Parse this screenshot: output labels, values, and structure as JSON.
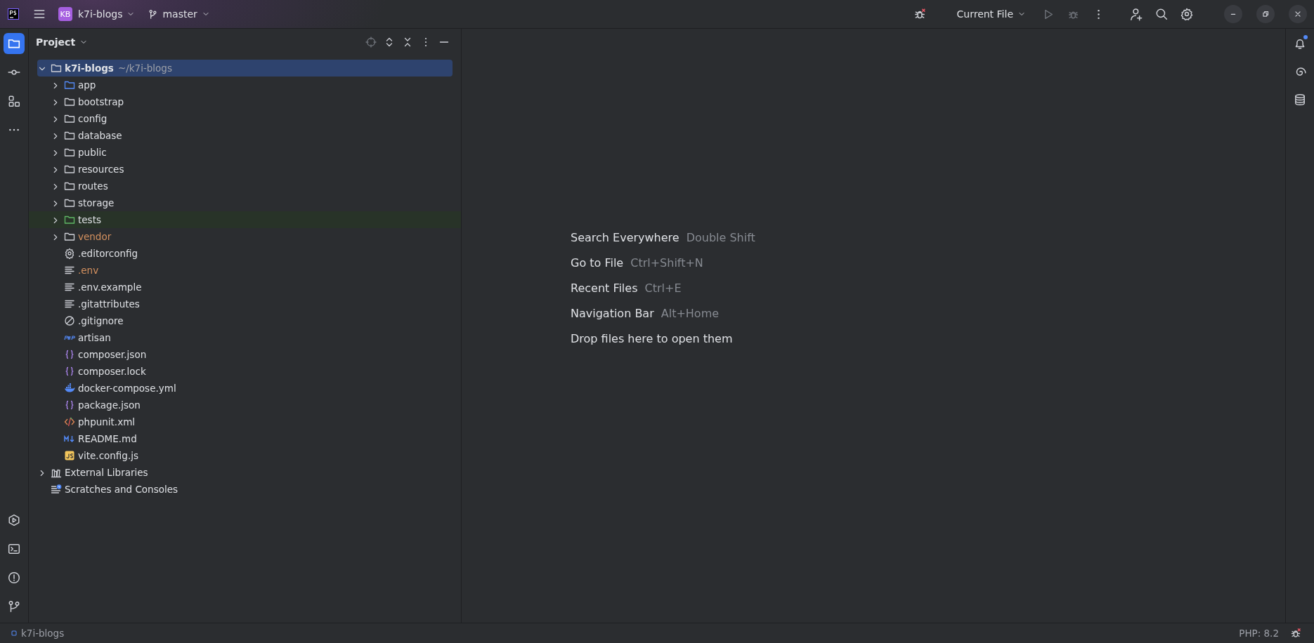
{
  "title_bar": {
    "project_badge": "KB",
    "project": "k7i-blogs",
    "branch": "master",
    "run_config": "Current File"
  },
  "left_tools": [
    {
      "kind": "project",
      "selected": true
    },
    {
      "kind": "commit",
      "selected": false
    },
    {
      "kind": "structure",
      "selected": false
    },
    {
      "kind": "more",
      "selected": false
    }
  ],
  "bottom_tools": [
    {
      "kind": "services"
    },
    {
      "kind": "terminal"
    },
    {
      "kind": "problems"
    },
    {
      "kind": "git"
    }
  ],
  "right_tools": [
    {
      "kind": "notifications",
      "unread": true
    },
    {
      "kind": "assistant"
    },
    {
      "kind": "database"
    }
  ],
  "project_panel": {
    "title": "Project",
    "tree": [
      {
        "label": "k7i-blogs",
        "path": "~/k7i-blogs",
        "kind": "folder",
        "excluded": false,
        "selected": true,
        "expanded": true,
        "children": [
          {
            "label": "app",
            "kind": "source-folder",
            "excluded": false,
            "selected": false,
            "expanded": false
          },
          {
            "label": "bootstrap",
            "kind": "folder",
            "excluded": false,
            "selected": false,
            "expanded": false
          },
          {
            "label": "config",
            "kind": "folder",
            "excluded": false,
            "selected": false,
            "expanded": false
          },
          {
            "label": "database",
            "kind": "folder",
            "excluded": false,
            "selected": false,
            "expanded": false
          },
          {
            "label": "public",
            "kind": "folder",
            "excluded": false,
            "selected": false,
            "expanded": false
          },
          {
            "label": "resources",
            "kind": "folder",
            "excluded": false,
            "selected": false,
            "expanded": false
          },
          {
            "label": "routes",
            "kind": "folder",
            "excluded": false,
            "selected": false,
            "expanded": false
          },
          {
            "label": "storage",
            "kind": "folder",
            "excluded": false,
            "selected": false,
            "expanded": false
          },
          {
            "label": "tests",
            "kind": "test-folder",
            "excluded": false,
            "selected": false,
            "expanded": false
          },
          {
            "label": "vendor",
            "kind": "folder",
            "excluded": true,
            "selected": false,
            "expanded": false
          },
          {
            "label": ".editorconfig",
            "kind": "settings",
            "excluded": false,
            "selected": false
          },
          {
            "label": ".env",
            "kind": "text",
            "excluded": true,
            "selected": false
          },
          {
            "label": ".env.example",
            "kind": "text",
            "excluded": false,
            "selected": false
          },
          {
            "label": ".gitattributes",
            "kind": "text",
            "excluded": false,
            "selected": false
          },
          {
            "label": ".gitignore",
            "kind": "ignore",
            "excluded": false,
            "selected": false
          },
          {
            "label": "artisan",
            "kind": "php",
            "excluded": false,
            "selected": false
          },
          {
            "label": "composer.json",
            "kind": "json",
            "excluded": false,
            "selected": false
          },
          {
            "label": "composer.lock",
            "kind": "json",
            "excluded": false,
            "selected": false
          },
          {
            "label": "docker-compose.yml",
            "kind": "docker",
            "excluded": false,
            "selected": false
          },
          {
            "label": "package.json",
            "kind": "json",
            "excluded": false,
            "selected": false
          },
          {
            "label": "phpunit.xml",
            "kind": "xml",
            "excluded": false,
            "selected": false
          },
          {
            "label": "README.md",
            "kind": "markdown",
            "excluded": false,
            "selected": false
          },
          {
            "label": "vite.config.js",
            "kind": "js",
            "excluded": false,
            "selected": false
          }
        ]
      },
      {
        "label": "External Libraries",
        "kind": "library",
        "excluded": false,
        "selected": false,
        "expanded": false
      },
      {
        "label": "Scratches and Consoles",
        "kind": "scratches",
        "excluded": false,
        "selected": false
      }
    ]
  },
  "editor_hints": [
    {
      "action": "Search Everywhere",
      "shortcut": "Double Shift"
    },
    {
      "action": "Go to File",
      "shortcut": "Ctrl+Shift+N"
    },
    {
      "action": "Recent Files",
      "shortcut": "Ctrl+E"
    },
    {
      "action": "Navigation Bar",
      "shortcut": "Alt+Home"
    },
    {
      "action": "Drop files here to open them"
    }
  ],
  "status_bar": {
    "project": "k7i-blogs",
    "interpreter": "PHP: 8.2"
  }
}
